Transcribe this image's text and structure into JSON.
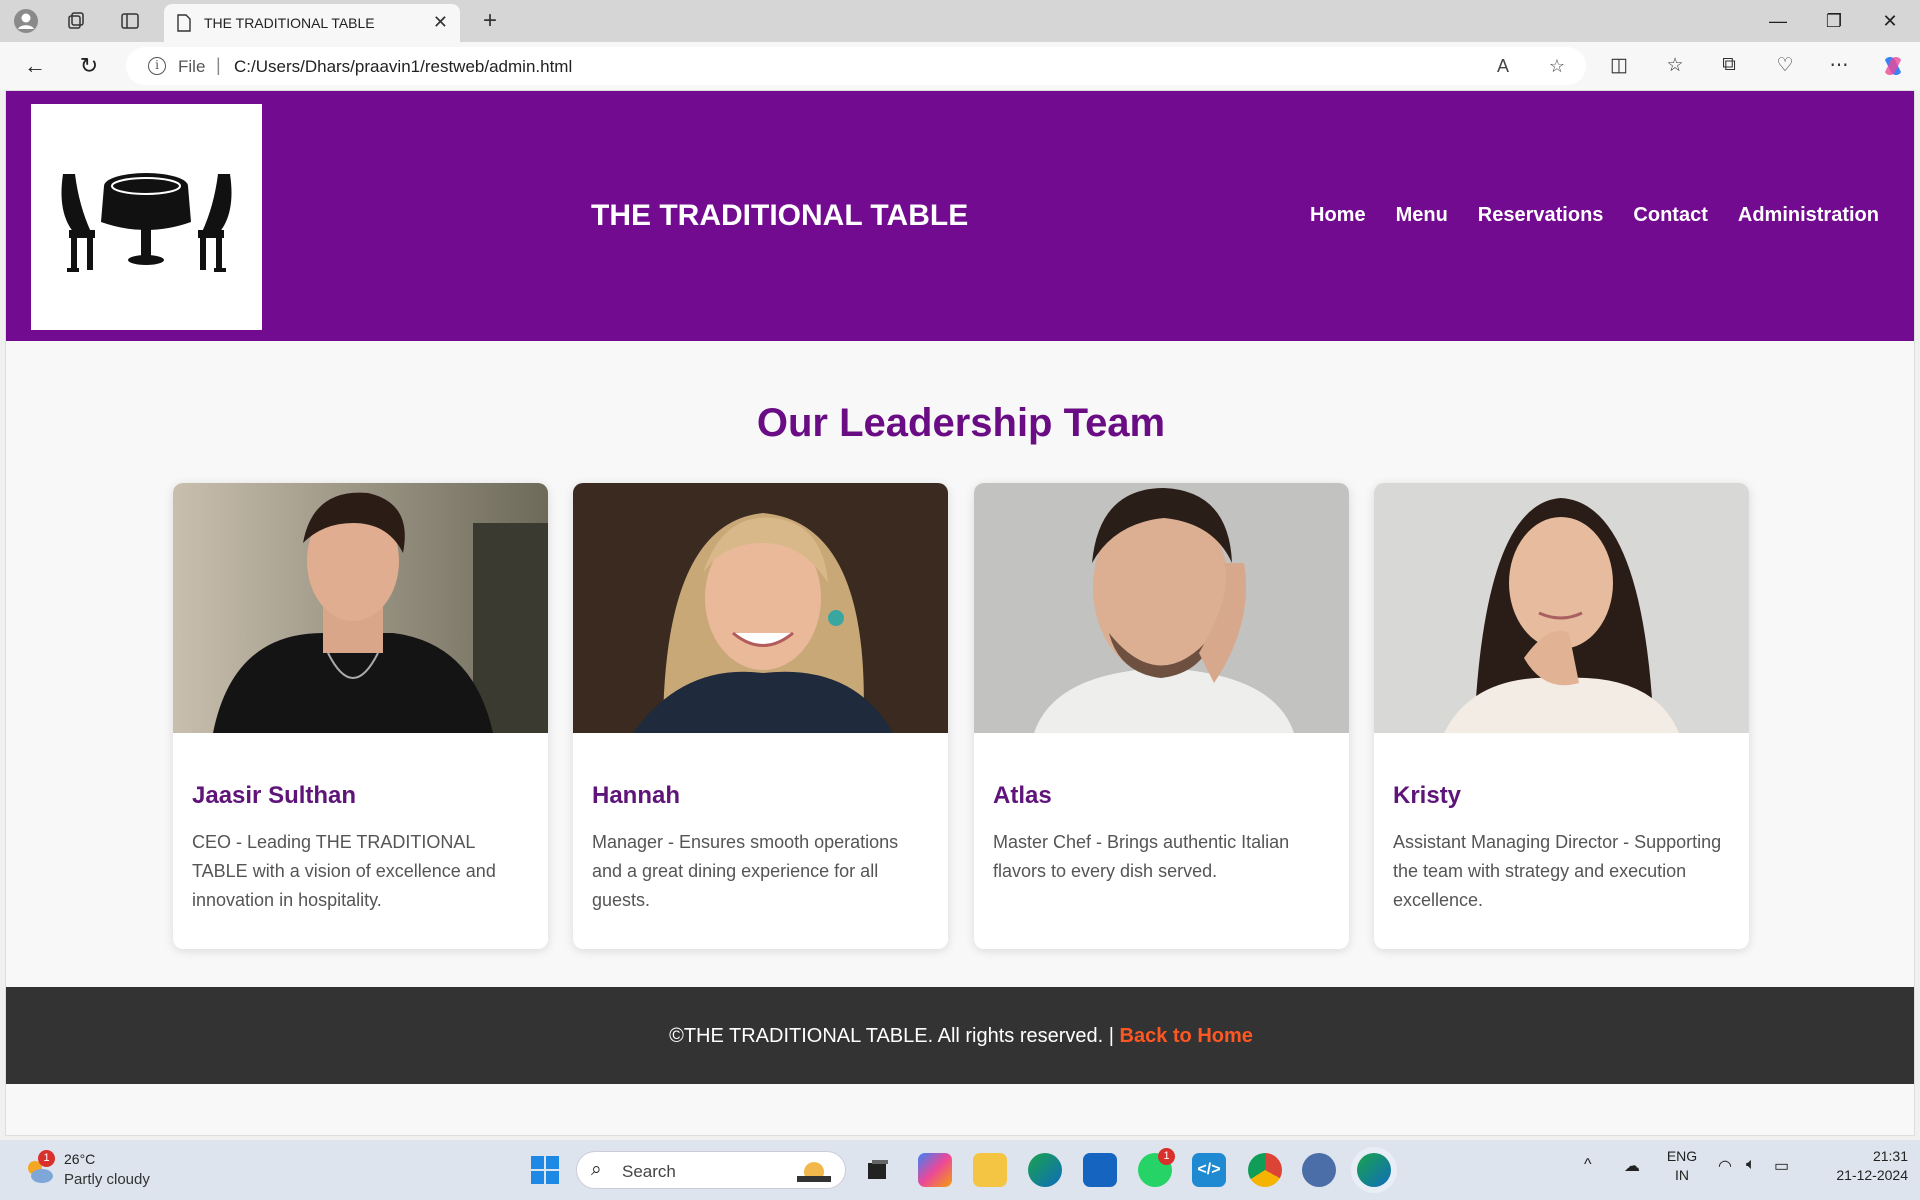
{
  "browser": {
    "tab_title": "THE TRADITIONAL TABLE",
    "url_scheme": "File",
    "url": "C:/Users/Dhars/praavin1/restweb/admin.html"
  },
  "site": {
    "title": "THE TRADITIONAL TABLE",
    "nav": [
      "Home",
      "Menu",
      "Reservations",
      "Contact",
      "Administration"
    ]
  },
  "team": {
    "heading": "Our Leadership Team",
    "members": [
      {
        "name": "Jaasir Sulthan",
        "description": "CEO - Leading THE TRADITIONAL TABLE with a vision of excellence and innovation in hospitality."
      },
      {
        "name": "Hannah",
        "description": "Manager - Ensures smooth operations and a great dining experience for all guests."
      },
      {
        "name": "Atlas",
        "description": "Master Chef - Brings authentic Italian flavors to every dish served."
      },
      {
        "name": "Kristy",
        "description": "Assistant Managing Director - Supporting the team with strategy and execution excellence."
      }
    ]
  },
  "footer": {
    "text": "©THE TRADITIONAL TABLE. All rights reserved. | ",
    "link": "Back to Home"
  },
  "taskbar": {
    "weather_temp": "26°C",
    "weather_desc": "Partly cloudy",
    "weather_badge": "1",
    "search_label": "Search",
    "whatsapp_badge": "1",
    "lang": "ENG",
    "region": "IN",
    "time": "21:31",
    "date": "21-12-2024"
  },
  "colors": {
    "header": "#730b91",
    "heading": "#6a0d85",
    "footer": "#333333",
    "footer_link": "#ff5722"
  }
}
